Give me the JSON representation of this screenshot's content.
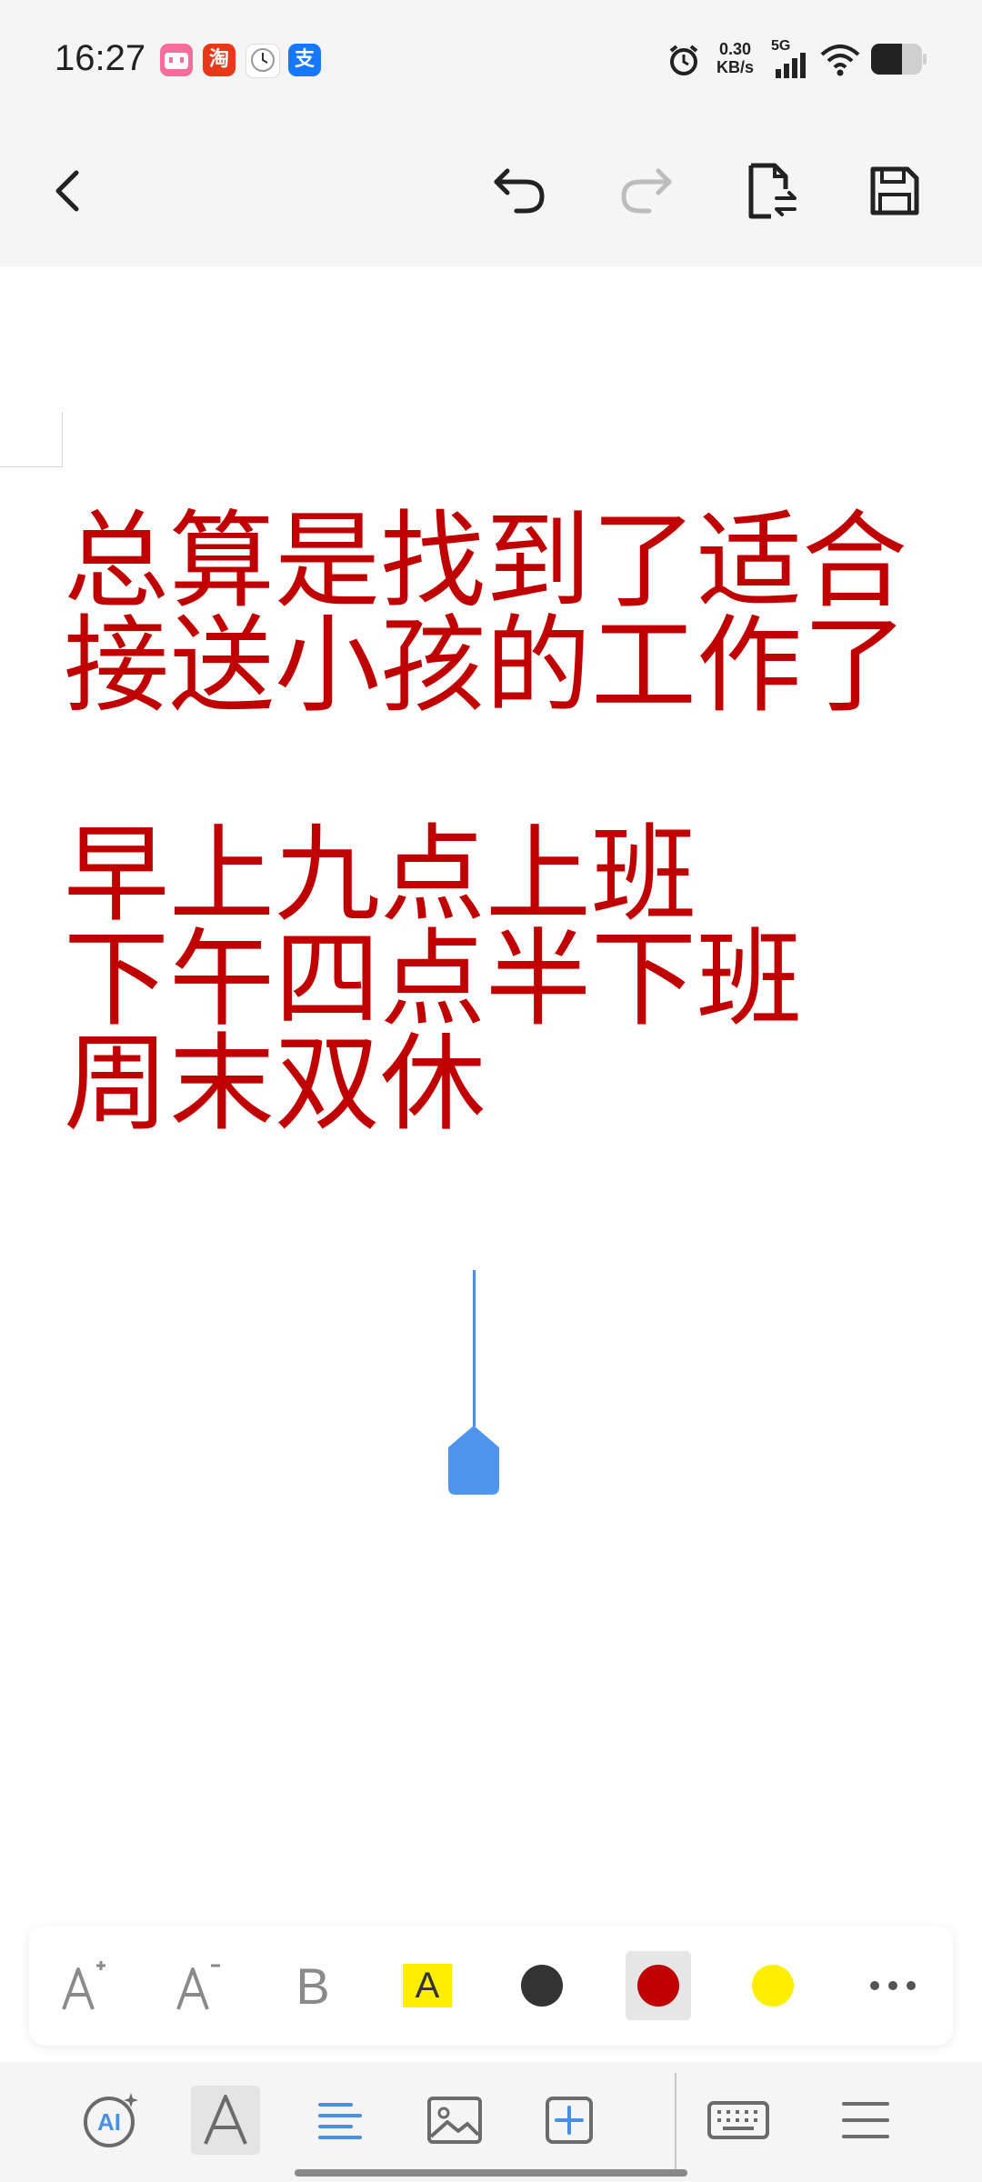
{
  "status_bar": {
    "time": "16:27",
    "notifications": [
      "bilibili-app-icon",
      "taobao-app-icon",
      "clock-app-icon",
      "alipay-app-icon"
    ],
    "taobao_label": "淘",
    "alipay_label": "支",
    "net_speed_value": "0.30",
    "net_speed_unit": "KB/s",
    "signal_label": "5G"
  },
  "toolbar": {
    "back_icon": "back-arrow-icon",
    "undo_icon": "undo-icon",
    "redo_icon": "redo-icon",
    "file_icon": "document-switch-icon",
    "save_icon": "save-icon"
  },
  "document": {
    "text_color": "#c00000",
    "lines": [
      "总算是找到了适合",
      "接送小孩的工作了",
      "",
      "早上九点上班",
      "下午四点半下班",
      "周末双休"
    ]
  },
  "format_panel": {
    "increase_font_icon": "font-increase-icon",
    "decrease_font_icon": "font-decrease-icon",
    "bold_label": "B",
    "highlight_label": "A",
    "colors": [
      "#333333",
      "#c00000",
      "#ffee00"
    ],
    "selected_color": "#c00000",
    "more_icon": "more-icon"
  },
  "bottom_bar": {
    "ai_label": "AI",
    "text_format_label": "A",
    "items": [
      "ai-icon",
      "text-format-icon",
      "paragraph-align-icon",
      "image-icon",
      "insert-icon",
      "keyboard-icon",
      "menu-icon"
    ]
  },
  "colors": {
    "accent": "#4a90e2",
    "text_red": "#c00000"
  }
}
